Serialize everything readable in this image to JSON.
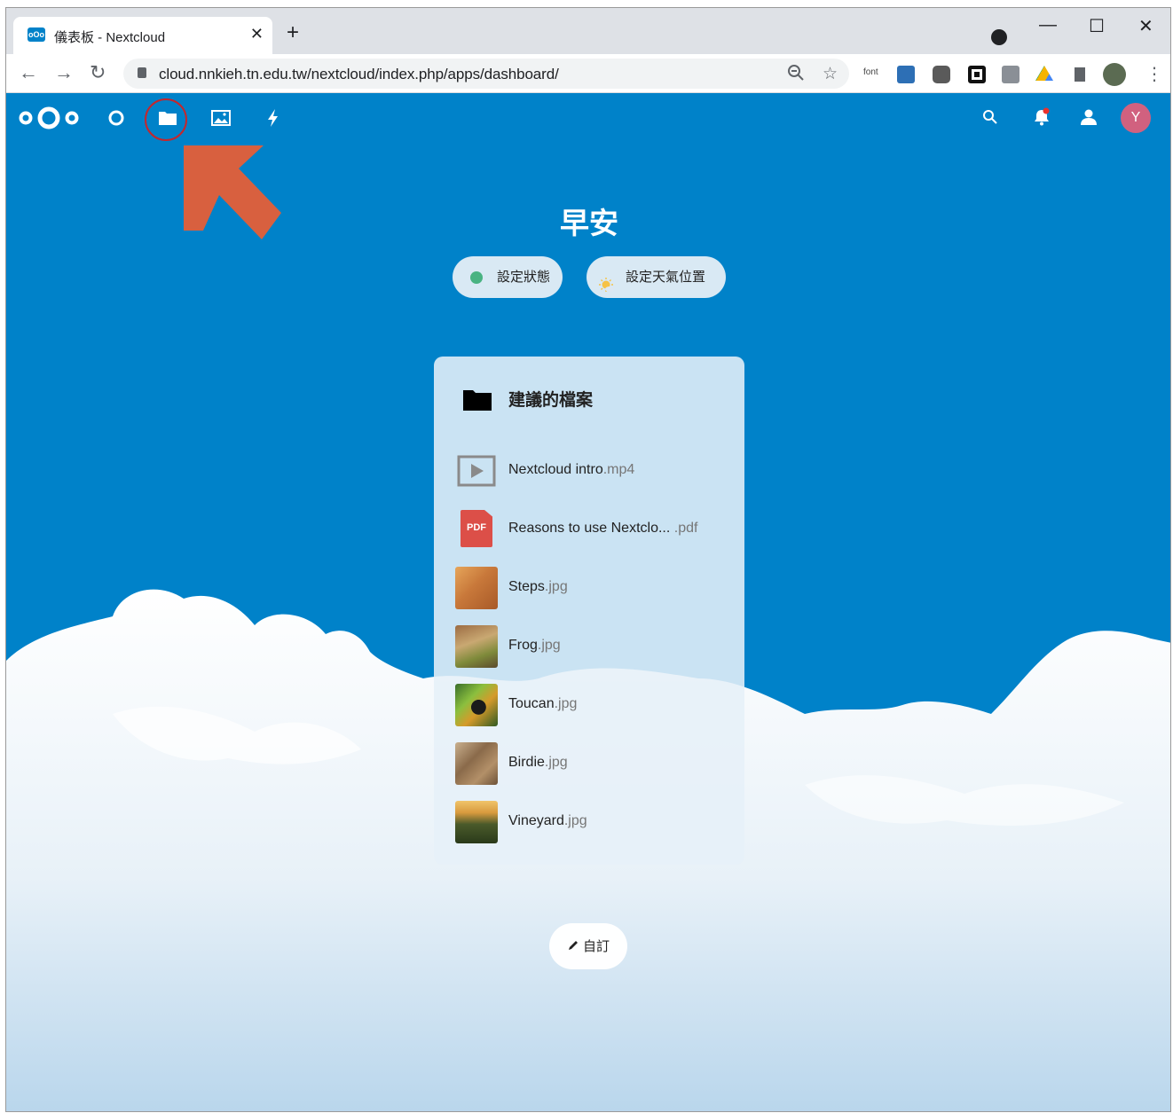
{
  "browser": {
    "tab_title": "儀表板 - Nextcloud",
    "tab_favicon_text": "oOo",
    "tab_close": "✕",
    "new_tab": "+",
    "window_controls": {
      "minimize": "—",
      "maximize": "☐",
      "close": "✕"
    },
    "nav": {
      "back": "←",
      "forward": "→",
      "reload": "↻"
    },
    "url": "cloud.nnkieh.tn.edu.tw/nextcloud/index.php/apps/dashboard/",
    "ext_font_label": "font"
  },
  "header": {
    "apps": [
      "dashboard-icon",
      "files-icon",
      "photos-icon",
      "activity-icon"
    ],
    "avatar_initial": "Y",
    "notification_dot_color": "#e9322d"
  },
  "colors": {
    "primary": "#0082c9",
    "annotation": "#d8603f",
    "status_online": "#49b382",
    "avatar": "#d1617f"
  },
  "main": {
    "greeting": "早安",
    "status_button": "設定狀態",
    "weather_button": "設定天氣位置",
    "customize_button": "自訂"
  },
  "widget": {
    "title": "建議的檔案",
    "files": [
      {
        "name": "Nextcloud intro",
        "ext": ".mp4",
        "icon": "video-icon"
      },
      {
        "name": "Reasons to use Nextclo...",
        "ext": " .pdf",
        "icon": "pdf-icon",
        "badge": "PDF"
      },
      {
        "name": "Steps",
        "ext": ".jpg",
        "icon": "image-thumbnail"
      },
      {
        "name": "Frog",
        "ext": ".jpg",
        "icon": "image-thumbnail"
      },
      {
        "name": "Toucan",
        "ext": ".jpg",
        "icon": "image-thumbnail"
      },
      {
        "name": "Birdie",
        "ext": ".jpg",
        "icon": "image-thumbnail"
      },
      {
        "name": "Vineyard",
        "ext": ".jpg",
        "icon": "image-thumbnail"
      }
    ]
  }
}
